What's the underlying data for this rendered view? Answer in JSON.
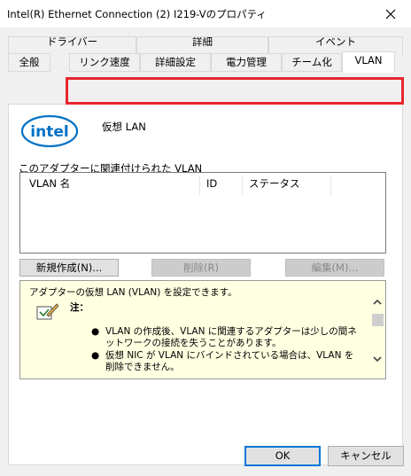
{
  "window": {
    "title": "Intel(R) Ethernet Connection (2) I219-Vのプロパティ",
    "close_icon": "close-icon"
  },
  "tabs": {
    "back_row": [
      "ドライバー",
      "詳細",
      "イベント"
    ],
    "front_row": [
      "全般",
      "リンク速度",
      "詳細設定",
      "電力管理",
      "チーム化",
      "VLAN"
    ],
    "active": "VLAN"
  },
  "highlight_color": "#e8262e",
  "panel": {
    "logo_text": "intel",
    "virtual_lan_label": "仮想 LAN",
    "assoc_label": "このアダプターに関連付けられた VLAN",
    "table": {
      "columns": [
        "VLAN 名",
        "ID",
        "ステータス"
      ],
      "rows": []
    },
    "buttons": {
      "new": "新規作成(N)...",
      "delete": "削除(R)",
      "edit": "編集(M)..."
    },
    "info": {
      "text": "アダプターの仮想 LAN (VLAN) を設定できます。",
      "note_label": "注：",
      "bullets": [
        "VLAN の作成後、VLAN に関連するアダプターは少しの間ネットワークの接続を失うことがあります。",
        "仮想 NIC が VLAN にバインドされている場合は、VLAN を削除できません。"
      ],
      "bullet_char": "●"
    }
  },
  "dialog_buttons": {
    "ok": "OK",
    "cancel": "キャンセル"
  },
  "colors": {
    "accent": "#0078d7",
    "info_bg": "#ffffe1",
    "intel_blue": "#0071c5"
  }
}
